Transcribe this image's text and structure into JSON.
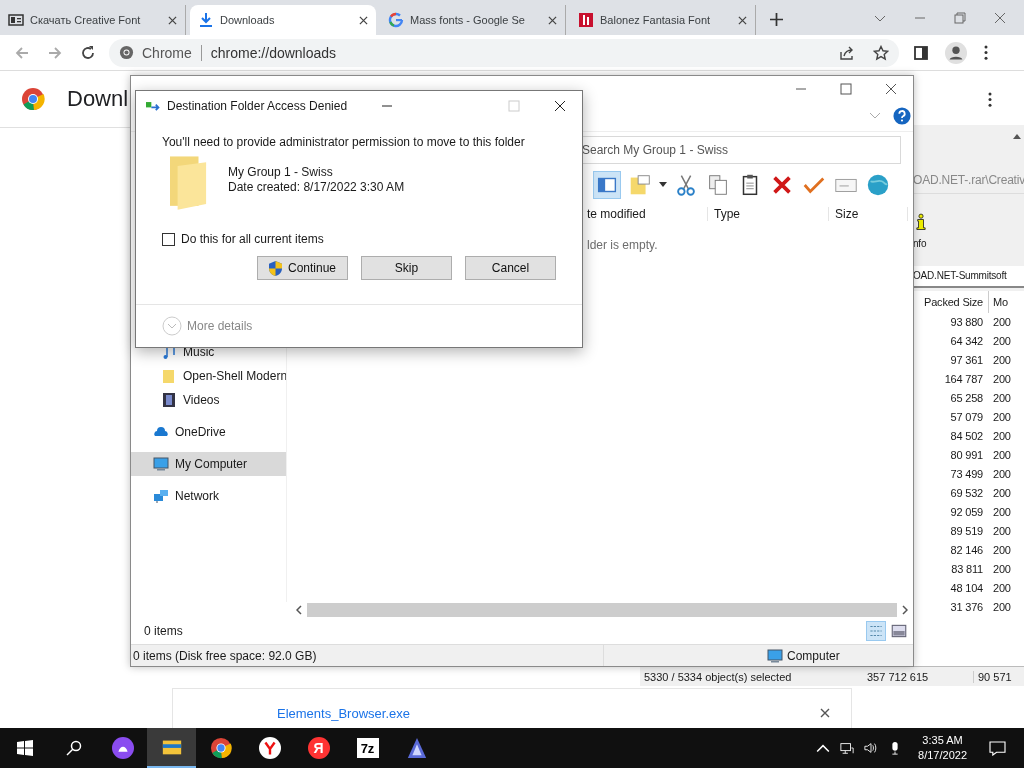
{
  "browser": {
    "tabs": [
      {
        "title": "Скачать Creative Font",
        "kind": "page",
        "selected": false
      },
      {
        "title": "Downloads",
        "kind": "download",
        "selected": true
      },
      {
        "title": "Mass fonts - Google Se",
        "kind": "google",
        "selected": false
      },
      {
        "title": "Balonez Fantasia Font",
        "kind": "brand",
        "selected": false
      }
    ],
    "address": {
      "chip": "Chrome",
      "url": "chrome://downloads"
    },
    "page_title": "Downl",
    "download": {
      "file": "Elements_Browser.exe"
    }
  },
  "archiver": {
    "path": "OAD.NET-.rar\\Creativ",
    "tool": "nfo",
    "folder": "OAD.NET-Summitsoft",
    "columns": [
      "Packed Size",
      "Mo"
    ],
    "rows": [
      {
        "packed": "93 880",
        "modified": "200"
      },
      {
        "packed": "64 342",
        "modified": "200"
      },
      {
        "packed": "97 361",
        "modified": "200"
      },
      {
        "packed": "164 787",
        "modified": "200"
      },
      {
        "packed": "65 258",
        "modified": "200"
      },
      {
        "packed": "57 079",
        "modified": "200"
      },
      {
        "packed": "84 502",
        "modified": "200"
      },
      {
        "packed": "80 991",
        "modified": "200"
      },
      {
        "packed": "73 499",
        "modified": "200"
      },
      {
        "packed": "69 532",
        "modified": "200"
      },
      {
        "packed": "92 059",
        "modified": "200"
      },
      {
        "packed": "89 519",
        "modified": "200"
      },
      {
        "packed": "82 146",
        "modified": "200"
      },
      {
        "packed": "83 811",
        "modified": "200"
      },
      {
        "packed": "48 104",
        "modified": "200"
      },
      {
        "packed": "31 376",
        "modified": "200"
      }
    ],
    "status": [
      "5330 / 5334 object(s) selected",
      "357 712 615",
      "90 571"
    ]
  },
  "explorer": {
    "search": {
      "placeholder": "Search My Group 1 - Swiss"
    },
    "columns": [
      "te modified",
      "Type",
      "Size"
    ],
    "empty_text": "lder is empty.",
    "nav_subitems": [
      {
        "label": "Music",
        "kind": "music",
        "selected": false
      },
      {
        "label": "Open-Shell Modern",
        "kind": "folder",
        "selected": false
      },
      {
        "label": "Videos",
        "kind": "video",
        "selected": false
      }
    ],
    "nav_items": [
      {
        "label": "OneDrive",
        "kind": "cloud",
        "selected": false
      },
      {
        "label": "My Computer",
        "kind": "computer",
        "selected": true
      },
      {
        "label": "Network",
        "kind": "network",
        "selected": false
      }
    ],
    "item_count": "0 items",
    "status": "0 items (Disk free space: 92.0 GB)",
    "status_location": "Computer"
  },
  "dialog": {
    "title": "Destination Folder Access Denied",
    "message": "You'll need to provide administrator permission to move to this folder",
    "folder_name": "My Group 1 - Swiss",
    "folder_date": "Date created: 8/17/2022 3:30 AM",
    "checkbox": {
      "label": "Do this for all current items",
      "checked": false
    },
    "buttons": [
      {
        "label": "Continue",
        "shield": true
      },
      {
        "label": "Skip",
        "shield": false
      },
      {
        "label": "Cancel",
        "shield": false
      }
    ],
    "more": "More details"
  },
  "taskbar": {
    "apps": [
      {
        "kind": "start",
        "active": false
      },
      {
        "kind": "search",
        "active": false
      },
      {
        "kind": "assistant",
        "active": false
      },
      {
        "kind": "explorer",
        "active": true
      },
      {
        "kind": "chrome",
        "active": false
      },
      {
        "kind": "ybrowser",
        "active": false
      },
      {
        "kind": "yandex",
        "glyph": "Я",
        "active": false
      },
      {
        "kind": "zip",
        "glyph": "7z",
        "active": false
      },
      {
        "kind": "app",
        "active": false
      }
    ],
    "time": "3:35 AM",
    "date": "8/17/2022"
  }
}
